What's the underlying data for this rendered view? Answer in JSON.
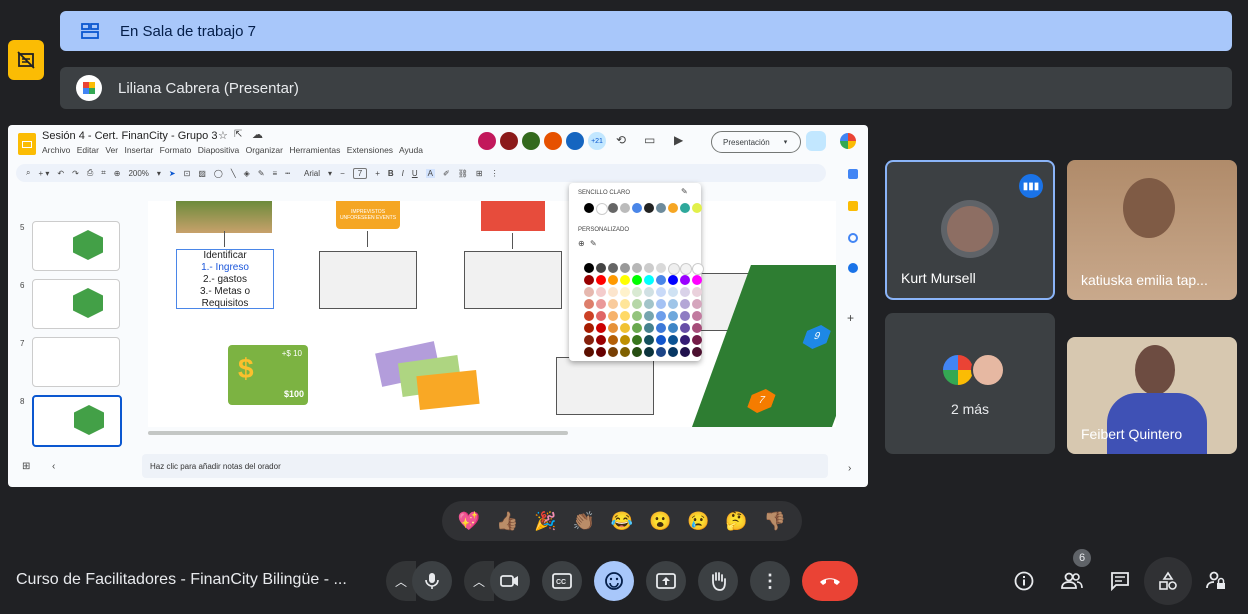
{
  "breakout": {
    "label": "En Sala de trabajo 7"
  },
  "presenter": {
    "label": "Liliana Cabrera (Presentar)"
  },
  "slides_app": {
    "doc_title": "Sesión 4 - Cert. FinanCity - Grupo 3",
    "menu": [
      "Archivo",
      "Editar",
      "Ver",
      "Insertar",
      "Formato",
      "Diapositiva",
      "Organizar",
      "Herramientas",
      "Extensiones",
      "Ayuda"
    ],
    "present_button": "Presentación",
    "avatar_count": "+21",
    "zoom": "200%",
    "font": "Arial",
    "font_size": "7",
    "slide_numbers": [
      "5",
      "6",
      "7",
      "8"
    ],
    "notes_placeholder": "Haz clic para añadir notas del orador",
    "palette": {
      "section1": "SENCILLO CLARO",
      "section2": "PERSONALIZADO"
    },
    "slide_text": {
      "line1": "Identificar",
      "line2": "1.- Ingreso",
      "line3": "2.- gastos",
      "line4": "3.- Metas o",
      "line5": "Requisitos",
      "sign": "IMPREVISTOS UNFORESEEN EVENTS",
      "card_amount": "$100",
      "card_top": "+$ 10",
      "badge1": "9",
      "badge2": "7"
    }
  },
  "participants": [
    {
      "name": "Kurt Mursell",
      "speaking": true
    },
    {
      "name": "katiuska emilia tap..."
    },
    {
      "name": "2 más"
    },
    {
      "name": "Feibert Quintero"
    }
  ],
  "reactions": [
    "💖",
    "👍🏽",
    "🎉",
    "👏🏽",
    "😂",
    "😮",
    "😢",
    "🤔",
    "👎🏽"
  ],
  "meeting": {
    "title": "Curso de Facilitadores - FinanCity Bilingüe - ...",
    "participant_count": "6"
  },
  "colors": {
    "accent": "#a8c7fa",
    "leave": "#ea4335",
    "emoji_active": "#a8c7fa",
    "speaking_border": "#8ab4f8"
  }
}
